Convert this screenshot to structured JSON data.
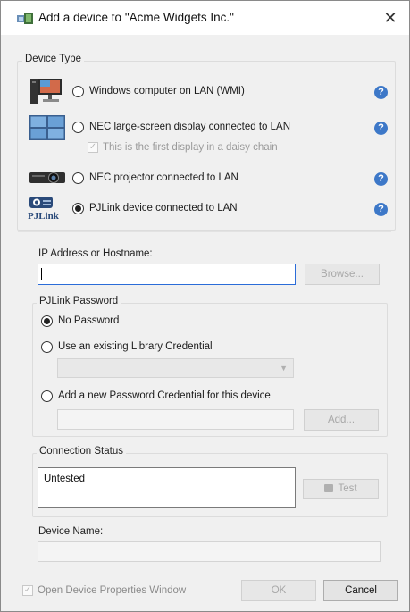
{
  "window": {
    "title": "Add a device to \"Acme Widgets Inc.\"",
    "close_glyph": "✕"
  },
  "device_type": {
    "legend": "Device Type",
    "options": [
      {
        "label": "Windows computer on LAN (WMI)",
        "icon": "windows-computer-icon",
        "selected": false
      },
      {
        "label": "NEC large-screen display connected to LAN",
        "icon": "large-screen-display-icon",
        "selected": false
      },
      {
        "label": "NEC projector connected to LAN",
        "icon": "projector-icon",
        "selected": false
      },
      {
        "label": "PJLink device connected to LAN",
        "icon": "pjlink-icon",
        "selected": true
      }
    ],
    "daisy_chain_label": "This is the first display in a daisy chain",
    "help_glyph": "?",
    "pjlink_logo_text": "PJLink"
  },
  "ip": {
    "label": "IP Address or Hostname:",
    "value": "",
    "browse_label": "Browse..."
  },
  "password": {
    "legend": "PJLink Password",
    "no_password_label": "No Password",
    "existing_label": "Use an existing Library Credential",
    "new_label": "Add a new Password Credential for this device",
    "add_label": "Add...",
    "combo_arrow": "▼"
  },
  "connection": {
    "legend": "Connection Status",
    "status_text": "Untested",
    "test_label": "Test"
  },
  "device_name": {
    "label": "Device Name:",
    "value": ""
  },
  "footer": {
    "open_props_label": "Open Device Properties Window",
    "ok_label": "OK",
    "cancel_label": "Cancel",
    "check_glyph": "✓"
  }
}
